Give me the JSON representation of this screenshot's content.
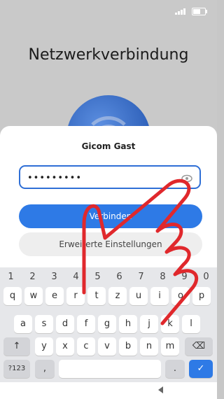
{
  "background": {
    "title": "Netzwerkverbindung"
  },
  "dialog": {
    "network_name": "Gicom Gast",
    "password_value": "•••••••••",
    "connect_label": "Verbinden",
    "advanced_label": "Erweiterte Einstellungen"
  },
  "keyboard": {
    "number_row": [
      "1",
      "2",
      "3",
      "4",
      "5",
      "6",
      "7",
      "8",
      "9",
      "0"
    ],
    "row1": [
      "q",
      "w",
      "e",
      "r",
      "t",
      "z",
      "u",
      "i",
      "o",
      "p"
    ],
    "row2": [
      "a",
      "s",
      "d",
      "f",
      "g",
      "h",
      "j",
      "k",
      "l"
    ],
    "row3": [
      "y",
      "x",
      "c",
      "v",
      "b",
      "n",
      "m"
    ],
    "shift_symbol": "↑",
    "backspace_symbol": "⌫",
    "symbols_label": "?123",
    "comma_label": ",",
    "period_label": ".",
    "enter_symbol": "✓"
  },
  "colors": {
    "accent": "#2e7ae6",
    "finger_outline": "#e0282c"
  },
  "icons": {
    "signal": "signal-icon",
    "battery": "battery-icon",
    "eye": "eye-icon",
    "back": "back-triangle-icon"
  }
}
